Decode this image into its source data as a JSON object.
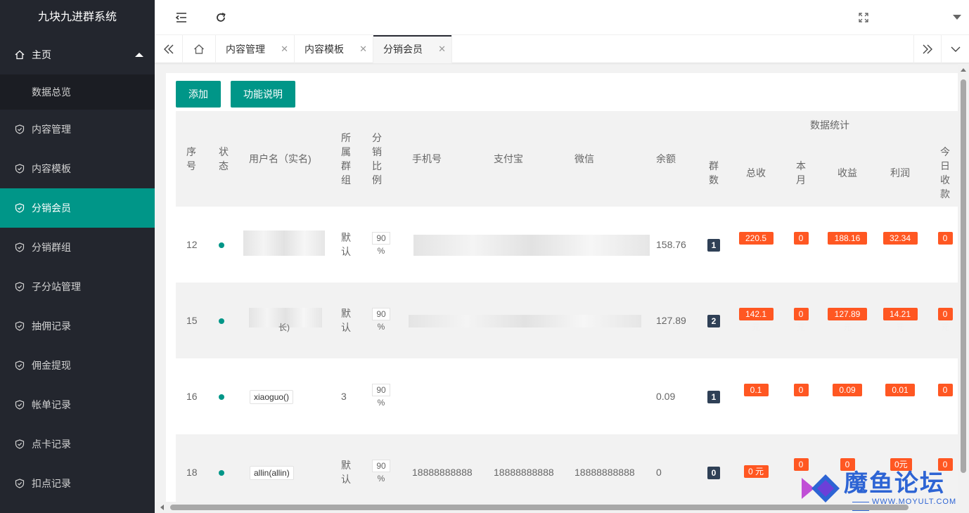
{
  "app": {
    "title": "九块九进群系统"
  },
  "sidebar": {
    "home": "主页",
    "home_sub": "数据总览",
    "items": [
      "内容管理",
      "内容模板",
      "分销会员",
      "分销群组",
      "子分站管理",
      "抽佣记录",
      "佣金提现",
      "帐单记录",
      "点卡记录",
      "扣点记录"
    ]
  },
  "tabs": [
    {
      "label": "内容管理"
    },
    {
      "label": "内容模板"
    },
    {
      "label": "分销会员"
    }
  ],
  "toolbar": {
    "add": "添加",
    "help": "功能说明"
  },
  "table": {
    "headers": {
      "seq": "序号",
      "status": "状态",
      "user": "用户名（实名)",
      "group": "所属群组",
      "ratio": "分销比例",
      "phone": "手机号",
      "alipay": "支付宝",
      "wechat": "微信",
      "balance": "余额",
      "groups": "群数",
      "stats": "数据统计",
      "total": "总收",
      "month": "本月",
      "income": "收益",
      "profit": "利润",
      "today": "今日收款"
    },
    "unit": "元",
    "rows": [
      {
        "seq": "12",
        "user": "",
        "group": "默认",
        "ratio": "90",
        "pct": "%",
        "phone": "",
        "alipay": "",
        "wechat": "",
        "balance": "158.76",
        "groups": "1",
        "total": "220.5",
        "month": "0",
        "income": "188.16",
        "profit": "32.34",
        "today": "0"
      },
      {
        "seq": "15",
        "user": "长)",
        "group": "默认",
        "ratio": "90",
        "pct": "%",
        "phone": "",
        "alipay": "",
        "wechat": "",
        "balance": "127.89",
        "groups": "2",
        "total": "142.1",
        "month": "0",
        "income": "127.89",
        "profit": "14.21",
        "today": "0"
      },
      {
        "seq": "16",
        "user": "xiaoguo()",
        "group": "3",
        "ratio": "90",
        "pct": "%",
        "phone": "",
        "alipay": "",
        "wechat": "",
        "balance": "0.09",
        "groups": "1",
        "total": "0.1",
        "month": "0",
        "income": "0.09",
        "profit": "0.01",
        "today": "0"
      },
      {
        "seq": "18",
        "user": "allin(allin)",
        "group": "默认",
        "ratio": "90",
        "pct": "%",
        "phone": "18888888888",
        "alipay": "18888888888",
        "wechat": "18888888888",
        "balance": "0",
        "groups": "0",
        "total": "0 元",
        "month": "0",
        "income": "0",
        "profit": "0元",
        "today": "0"
      }
    ]
  },
  "watermark": {
    "text": "魔鱼论坛",
    "url": "WWW.MOYULT.COM"
  }
}
